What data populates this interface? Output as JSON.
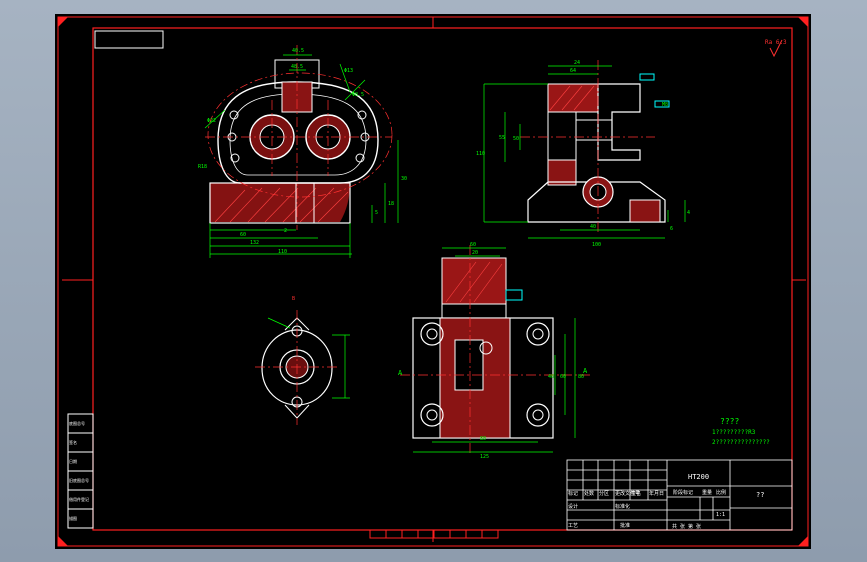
{
  "colors": {
    "background": "#000000",
    "border": "#ff2020",
    "geometry": "#ffffff",
    "dimension": "#00ff00",
    "hatch": "#ff2020",
    "centerline": "#ff3030",
    "yellow": "#ffff00",
    "cyan": "#00ffff"
  },
  "icons": [
    "roughness-symbol-icon"
  ],
  "labels": {
    "section_a_left": "A",
    "section_a_right": "A",
    "view_b": "B",
    "roughness_corner": "Ra 6.3"
  },
  "notes": {
    "title": "????",
    "line1": "1?????????R3",
    "line2": "2???????????????"
  },
  "title_block": {
    "material": "HT200",
    "name": "??",
    "revision_cells": [
      "标记",
      "处数",
      "分区",
      "更改文件号",
      "签名",
      "年月日"
    ],
    "design_row": [
      "设计",
      "标准化"
    ],
    "process_row": [
      "工艺",
      "批准"
    ],
    "stage_header": "阶段标记",
    "weight_header": "重量",
    "scale_header": "比例",
    "scale_value": "1:1",
    "sheet_info": "共  张  第  张"
  },
  "side_table": [
    "底图总号",
    "签名",
    "日期",
    "旧底图总号",
    "借用件登记",
    "描图"
  ],
  "dimensions": {
    "front": [
      "40.5",
      "48.5",
      "Φ13",
      "Φ8.5",
      "Φ22",
      "R18",
      "110",
      "132",
      "60",
      "30",
      "18",
      "5",
      "2"
    ],
    "side": [
      "64",
      "24",
      "55",
      "110",
      "50",
      "40",
      "100",
      "M8",
      "4",
      "6"
    ],
    "section": [
      "80",
      "60",
      "40",
      "125",
      "80",
      "60",
      "20"
    ]
  }
}
